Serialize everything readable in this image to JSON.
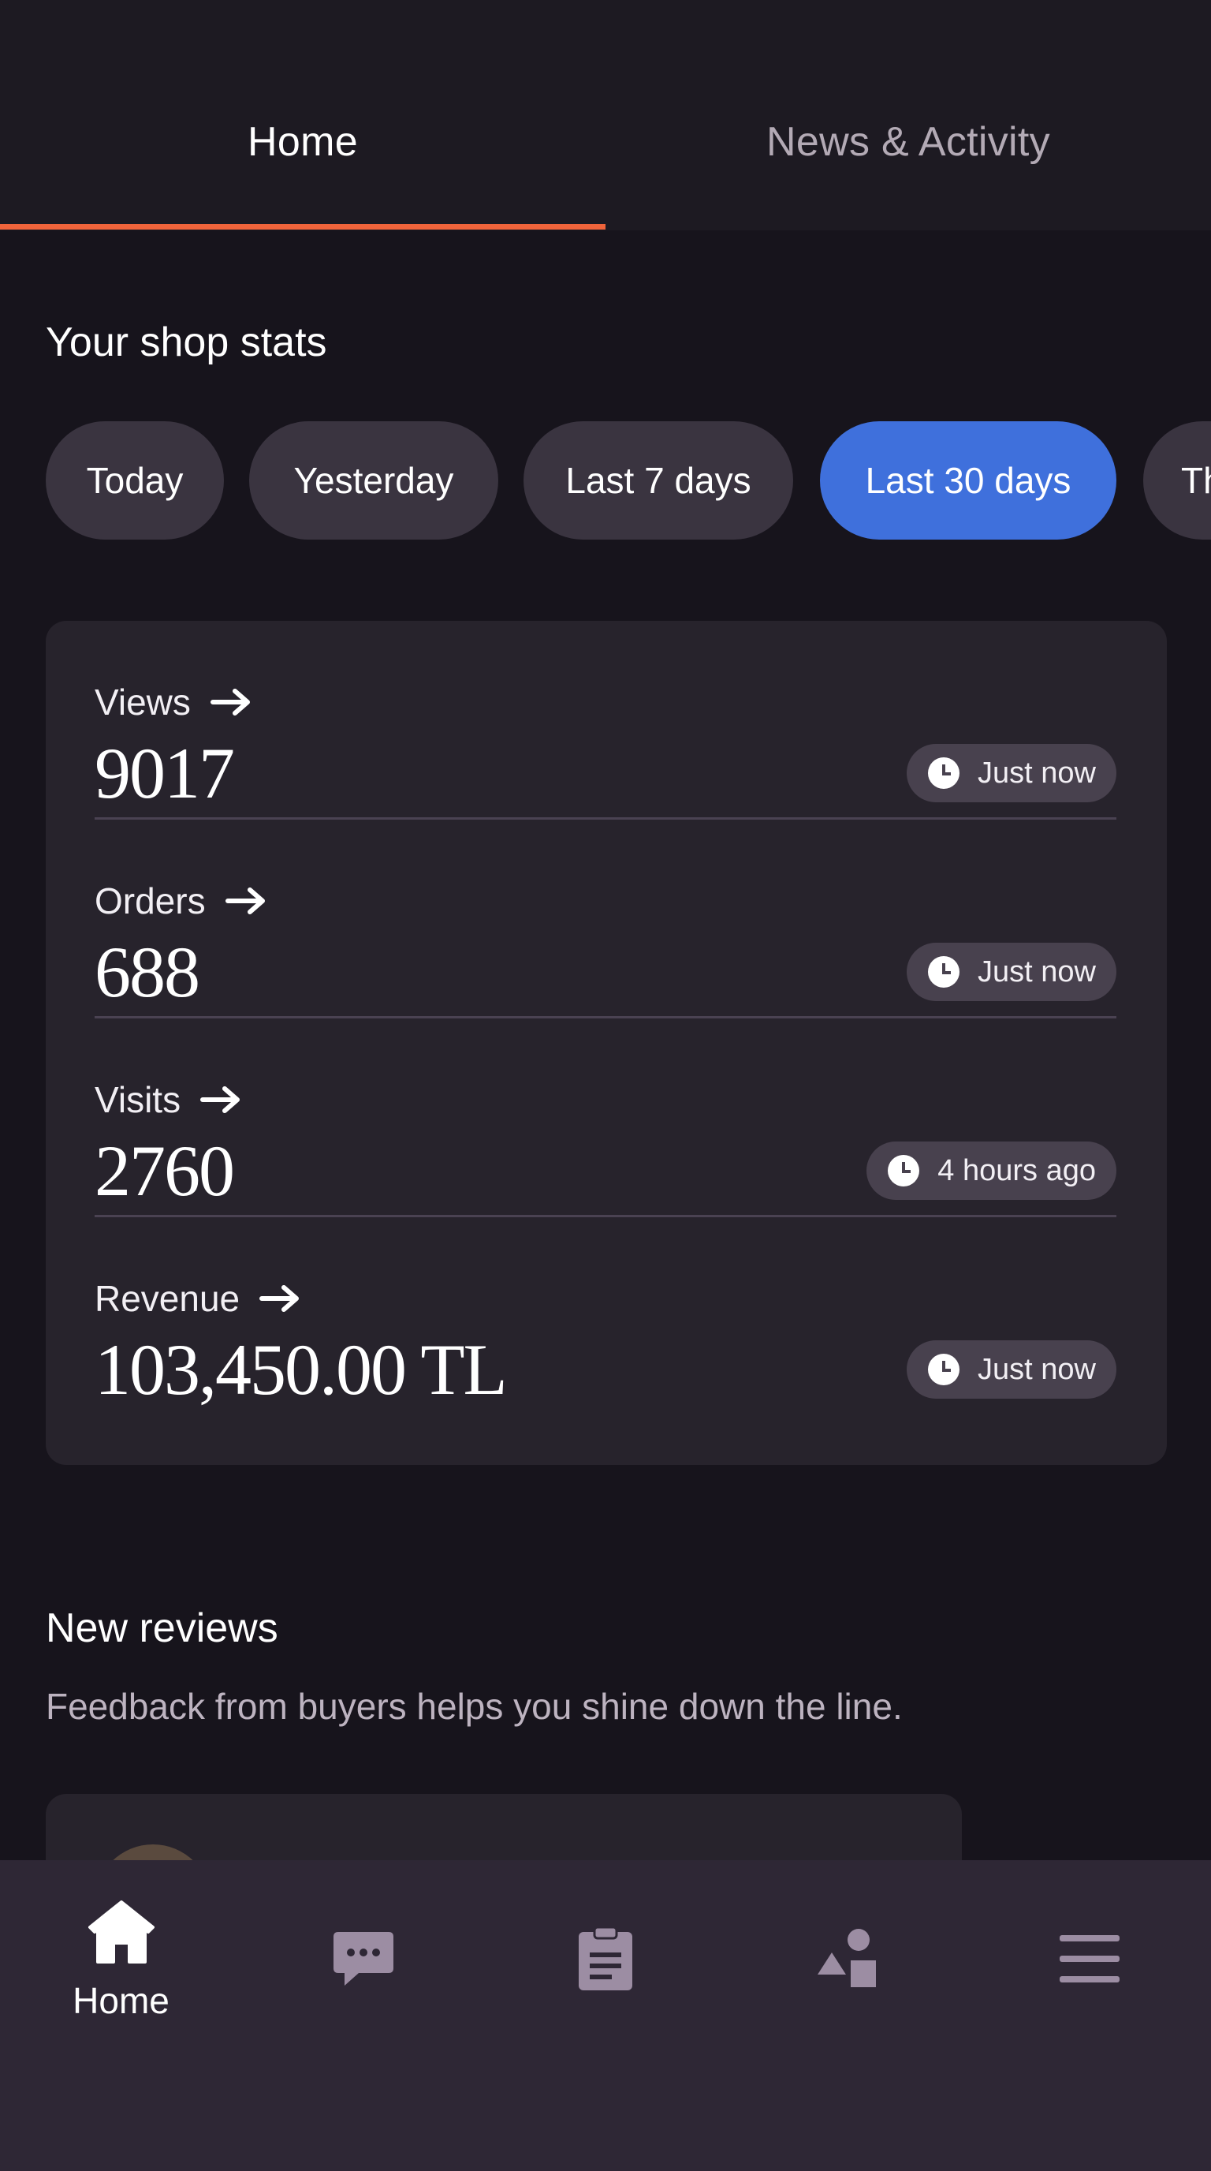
{
  "tabs": {
    "home": "Home",
    "news": "News & Activity"
  },
  "shop_stats": {
    "title": "Your shop stats",
    "filters": [
      {
        "label": "Today",
        "active": false
      },
      {
        "label": "Yesterday",
        "active": false
      },
      {
        "label": "Last 7 days",
        "active": false
      },
      {
        "label": "Last 30 days",
        "active": true
      },
      {
        "label": "Th",
        "active": false
      }
    ],
    "stats": [
      {
        "label": "Views",
        "value": "9017",
        "updated": "Just now"
      },
      {
        "label": "Orders",
        "value": "688",
        "updated": "Just now"
      },
      {
        "label": "Visits",
        "value": "2760",
        "updated": "4 hours ago"
      },
      {
        "label": "Revenue",
        "value": "103,450.00 TL",
        "updated": "Just now"
      }
    ]
  },
  "reviews": {
    "title": "New reviews",
    "subtitle": "Feedback from buyers helps you shine down the line."
  },
  "bottom_nav": {
    "items": [
      {
        "icon": "home-icon",
        "label": "Home",
        "active": true
      },
      {
        "icon": "messages-icon",
        "label": "",
        "active": false
      },
      {
        "icon": "orders-clipboard-icon",
        "label": "",
        "active": false
      },
      {
        "icon": "listings-shapes-icon",
        "label": "",
        "active": false
      },
      {
        "icon": "menu-icon",
        "label": "",
        "active": false
      }
    ]
  },
  "colors": {
    "background": "#17141c",
    "card": "#27232c",
    "accent_tab": "#f0643b",
    "active_chip": "#3f70dc",
    "nav_icon_inactive": "#9c8da3"
  }
}
